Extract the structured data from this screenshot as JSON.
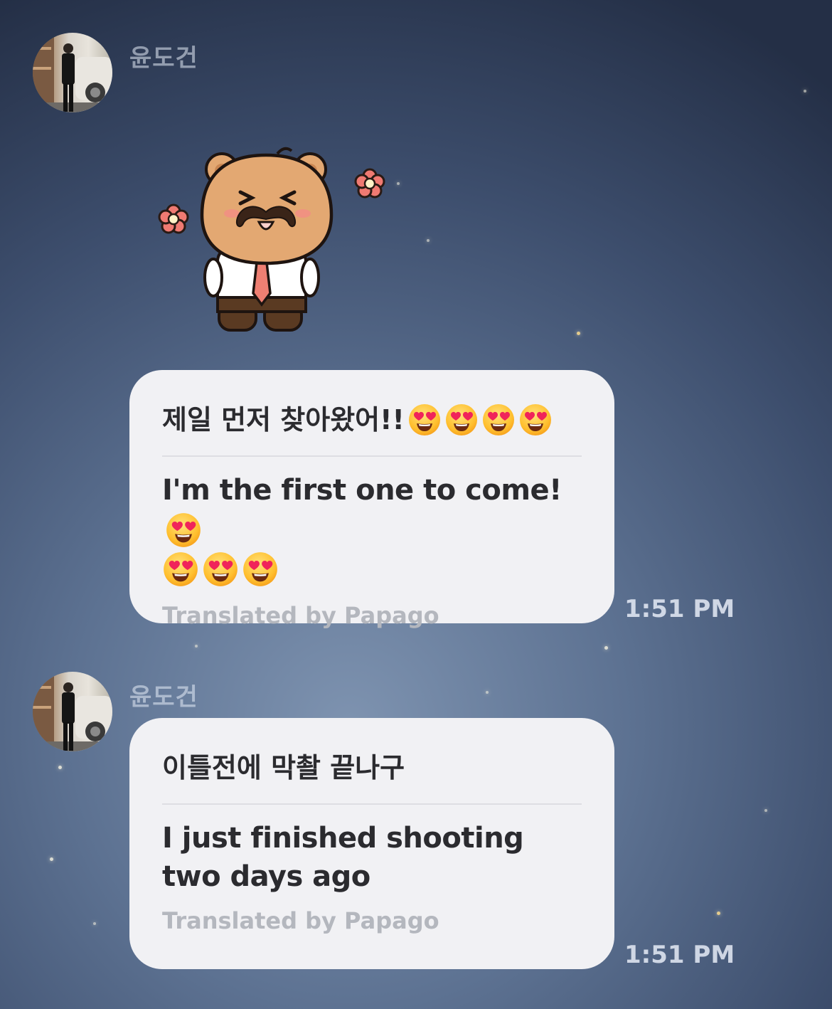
{
  "messages": [
    {
      "sender": "윤도건",
      "original": "제일 먼저 찾아왔어!!",
      "translation_text": "I'm the first one to come!",
      "translation_credit": "Translated by Papago",
      "time": "1:51 PM",
      "sticker_icon": "bear-mustache-sticker",
      "emoji_icon": "heart-eyes-emoji"
    },
    {
      "sender": "윤도건",
      "original": "이틀전에 막촬 끝나구",
      "translation_text": "I just finished shooting two days ago",
      "translation_credit": "Translated by Papago",
      "time": "1:51 PM"
    }
  ],
  "colors": {
    "bubble": "#f1f1f4",
    "text": "#2b2b2f",
    "credit": "#b4b7be",
    "background_center": "#7e93b0",
    "background_edge": "#242f46"
  }
}
